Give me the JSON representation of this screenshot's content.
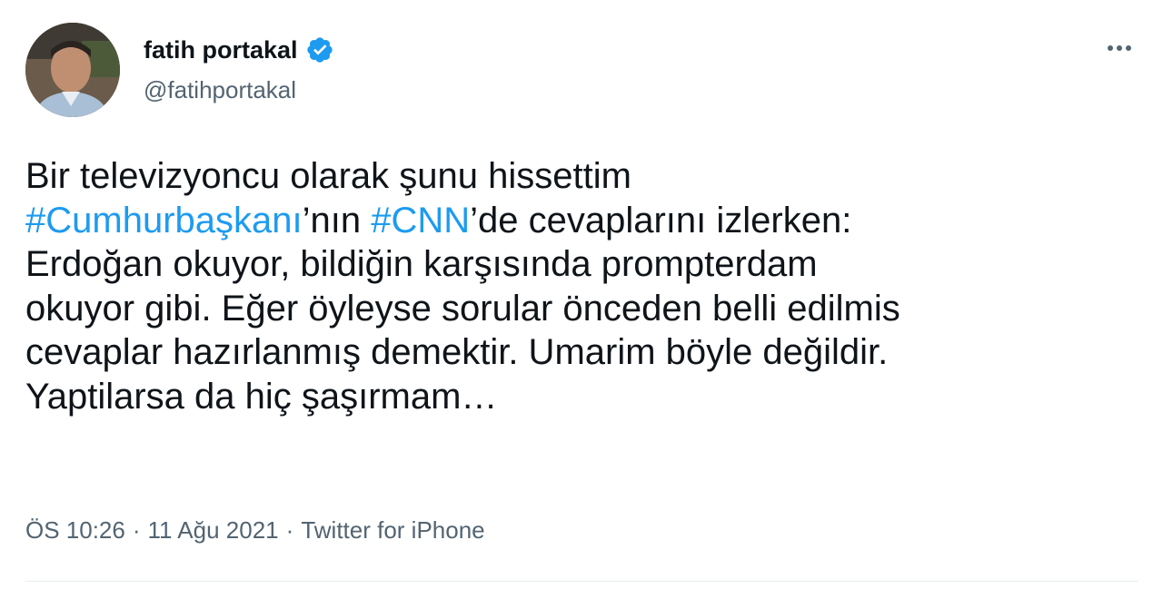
{
  "author": {
    "display_name": "fatih portakal",
    "handle": "@fatihportakal",
    "verified": true,
    "verified_icon": "verified-badge-icon"
  },
  "actions": {
    "more_icon": "more-horizontal-icon"
  },
  "tweet": {
    "lines": [
      [
        {
          "text": "Bir televizyoncu olarak şunu hissettim",
          "type": "text"
        }
      ],
      [
        {
          "text": "#Cumhurbaşkanı",
          "type": "hashtag"
        },
        {
          "text": "’nın ",
          "type": "text"
        },
        {
          "text": "#CNN",
          "type": "hashtag"
        },
        {
          "text": "’de cevaplarını izlerken:",
          "type": "text"
        }
      ],
      [
        {
          "text": "Erdoğan okuyor, bildiğin karşısında prompterdam",
          "type": "text"
        }
      ],
      [
        {
          "text": "okuyor gibi. Eğer öyleyse sorular önceden belli edilmis",
          "type": "text"
        }
      ],
      [
        {
          "text": "cevaplar hazırlanmış demektir. Umarim böyle değildir.",
          "type": "text"
        }
      ],
      [
        {
          "text": "Yaptilarsa da hiç şaşırmam…",
          "type": "text"
        }
      ]
    ]
  },
  "meta": {
    "time": "ÖS 10:26",
    "date": "11 Ağu 2021",
    "source": "Twitter for iPhone",
    "separator": "·"
  },
  "colors": {
    "text": "#0f1419",
    "secondary": "#536471",
    "accent": "#1d9bf0",
    "divider": "#e6ecf0"
  }
}
